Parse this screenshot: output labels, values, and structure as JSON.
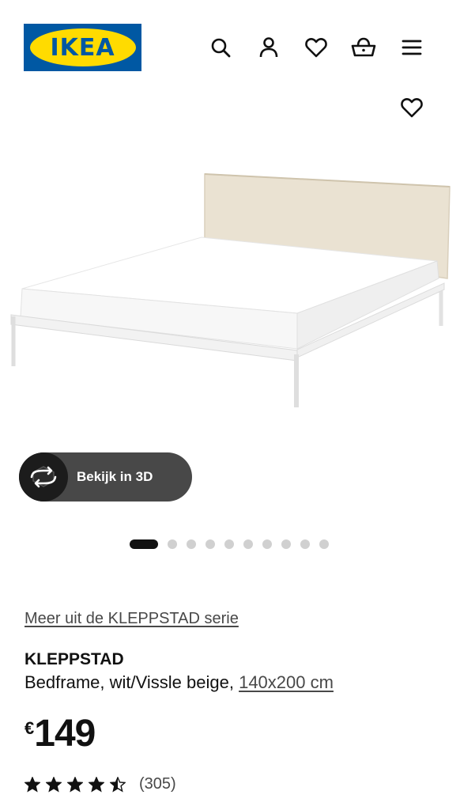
{
  "header": {
    "logo_text": "IKEA",
    "icons": [
      "search-icon",
      "user-icon",
      "heart-icon",
      "basket-icon",
      "menu-icon"
    ]
  },
  "product": {
    "favorite_icon": "heart-icon",
    "view_3d_label": "Bekijk in 3D",
    "series_link": "Meer uit de KLEPPSTAD serie",
    "name": "KLEPPSTAD",
    "description": "Bedframe, wit/Vissle beige,",
    "size_link": "140x200 cm",
    "currency": "€",
    "price": "149",
    "rating": 4.5,
    "rating_count": "(305)"
  },
  "carousel": {
    "total": 10,
    "active_index": 0
  },
  "colors": {
    "ikea_blue": "#0058a3",
    "ikea_yellow": "#ffdb00",
    "button_dark": "#484848",
    "text": "#111111"
  }
}
